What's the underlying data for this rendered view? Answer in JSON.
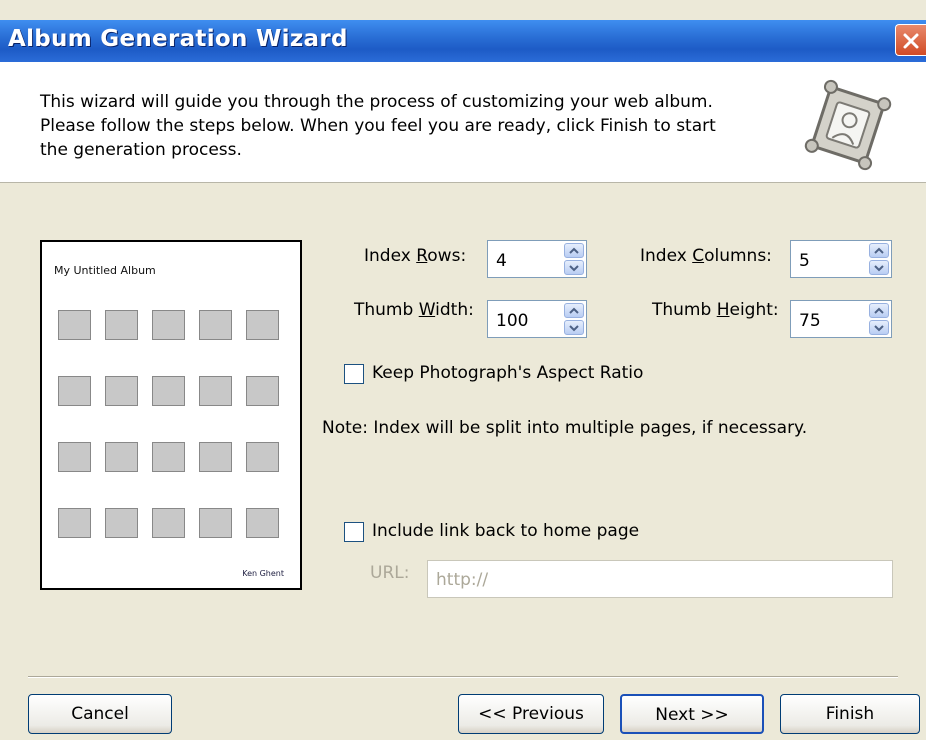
{
  "window": {
    "title": "Album Generation Wizard"
  },
  "header": {
    "intro_lines": [
      "This wizard will guide you through the process of customizing your web album.",
      "Please follow the steps below. When you feel you are ready, click Finish to start",
      "the generation process."
    ]
  },
  "preview": {
    "title": "My Untitled Album",
    "rows": 4,
    "columns": 5,
    "footer": "Ken Ghent"
  },
  "fields": {
    "index_rows": {
      "label_pre": "Index ",
      "label_key": "R",
      "label_post": "ows:",
      "value": "4"
    },
    "index_columns": {
      "label_pre": "Index ",
      "label_key": "C",
      "label_post": "olumns:",
      "value": "5"
    },
    "thumb_width": {
      "label_pre": "Thumb ",
      "label_key": "W",
      "label_post": "idth:",
      "value": "100"
    },
    "thumb_height": {
      "label_pre": "Thumb ",
      "label_key": "H",
      "label_post": "eight:",
      "value": "75"
    }
  },
  "aspect_ratio": {
    "label": "Keep Photograph's Aspect Ratio",
    "checked": false
  },
  "note": "Note: Index will be split into multiple pages, if necessary.",
  "home_link": {
    "label": "Include link back to home page",
    "checked": false
  },
  "url": {
    "label": "URL:",
    "value": "http://",
    "enabled": false
  },
  "buttons": {
    "cancel": "Cancel",
    "previous": "<< Previous",
    "next": "Next >>",
    "finish": "Finish"
  },
  "colors": {
    "titlebar": "#2a6fd6",
    "dialog_bg": "#ece9d8",
    "close": "#d14b25"
  }
}
